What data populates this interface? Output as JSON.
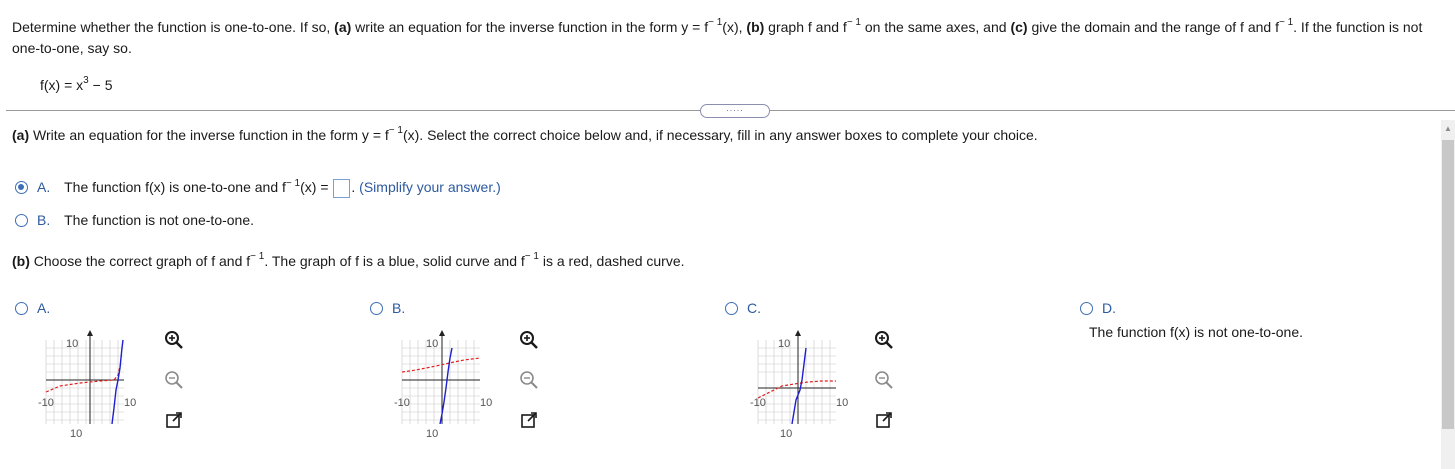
{
  "question": {
    "prefix": "Determine whether the function is one-to-one.  If so, ",
    "a_label": "(a)",
    "a_text_1": " write an equation for the inverse function in the form y = f",
    "inv_sup": "− 1",
    "a_text_2": "(x), ",
    "b_label": "(b)",
    "b_text": " graph f and f",
    "b_text_2": " on the same axes, and ",
    "c_label": "(c)",
    "c_text": " give the domain and the range of f and f",
    "c_text_2": ". If the function is not one-to-one, say so.",
    "function_prefix": "f(x) = x",
    "function_exp": "3",
    "function_suffix": " − 5"
  },
  "divider_handle": ".....",
  "part_a": {
    "label": "(a)",
    "text_1": " Write an equation for the inverse function in the form y = f",
    "sup": "− 1",
    "text_2": "(x). Select the correct choice below and, if necessary, fill in any answer boxes to complete your choice.",
    "choices": [
      {
        "letter": "A.",
        "text_1": "The function f(x) is one-to-one and f",
        "sup": "− 1",
        "text_2": "(x) = ",
        "hint": "(Simplify your answer.)",
        "selected": true
      },
      {
        "letter": "B.",
        "text_1": "The function is not one-to-one.",
        "selected": false
      }
    ]
  },
  "part_b": {
    "label": "(b)",
    "text_1": " Choose the correct graph of f and f",
    "sup": "− 1",
    "text_2": ". The graph of f is a blue, solid curve and f",
    "text_3": " is a red, dashed curve.",
    "options": [
      {
        "letter": "A.",
        "tick_top": "10",
        "tick_bottom": "10",
        "tick_left": "-10",
        "tick_right": "10"
      },
      {
        "letter": "B.",
        "tick_top": "10",
        "tick_bottom": "10",
        "tick_left": "-10",
        "tick_right": "10"
      },
      {
        "letter": "C.",
        "tick_top": "10",
        "tick_bottom": "10",
        "tick_left": "-10",
        "tick_right": "10"
      },
      {
        "letter": "D.",
        "text": "The function f(x) is not one-to-one."
      }
    ]
  },
  "colors": {
    "f_curve": "#1f1fd0",
    "inverse_curve": "#e02020",
    "accent": "#3d6fb6"
  },
  "icons": [
    "zoom-in-icon",
    "zoom-out-icon",
    "expand-icon"
  ]
}
